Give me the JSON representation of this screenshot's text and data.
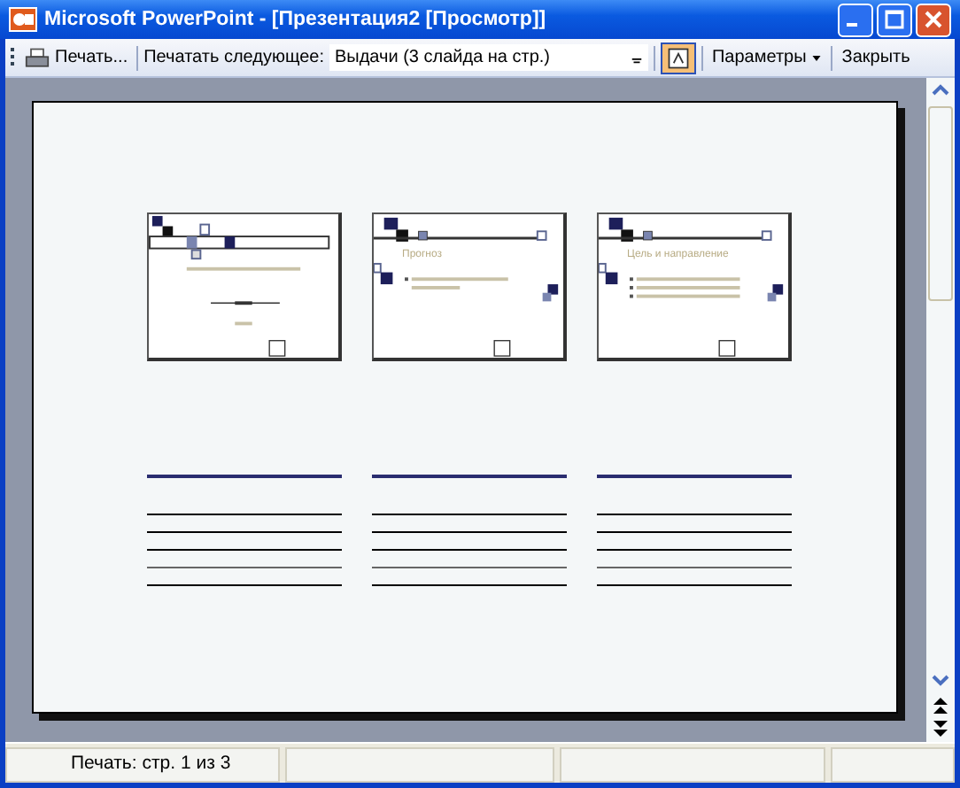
{
  "window": {
    "title": "Microsoft PowerPoint - [Презентация2 [Просмотр]]"
  },
  "toolbar": {
    "print_button": "Печать...",
    "print_what_label": "Печатать следующее:",
    "print_what_value": "Выдачи (3 слайда на стр.)",
    "color_toggle": {
      "selected": true
    },
    "options_button": "Параметры",
    "close_button": "Закрыть"
  },
  "slides": [
    {
      "kind": "title"
    },
    {
      "kind": "single-bullet",
      "title": "Прогноз"
    },
    {
      "kind": "bullet-list",
      "title": "Цель и направление"
    }
  ],
  "status_bar": {
    "text": "Печать: стр. 1 из 3"
  }
}
